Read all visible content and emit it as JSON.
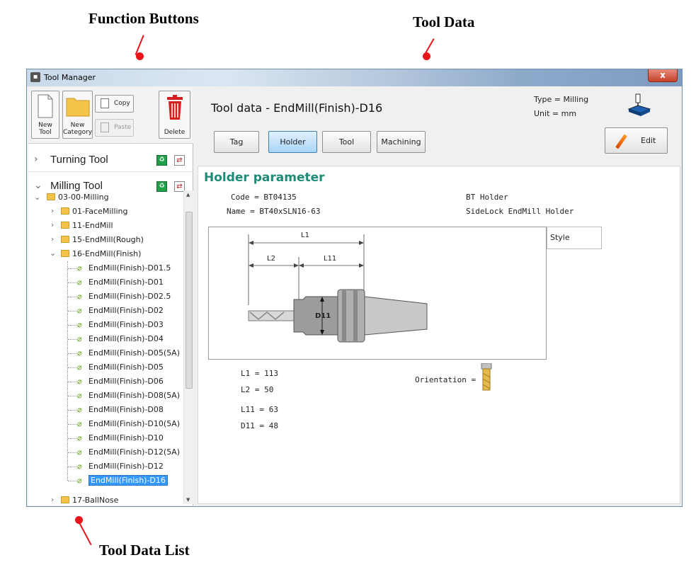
{
  "callouts": {
    "function_buttons": "Function Buttons",
    "tool_data": "Tool Data",
    "tool_data_list": "Tool Data List"
  },
  "window": {
    "title": "Tool Manager",
    "close": "x"
  },
  "toolbar": {
    "new_tool": "New Tool",
    "new_category": "New Category",
    "copy": "Copy",
    "paste": "Paste",
    "delete": "Delete"
  },
  "sections": {
    "turning": "Turning Tool",
    "milling": "Milling Tool"
  },
  "tree": {
    "root": "03-00-Milling",
    "folders": [
      "01-FaceMilling",
      "11-EndMill",
      "15-EndMill(Rough)",
      "16-EndMill(Finish)"
    ],
    "leaves": [
      "EndMill(Finish)-D01.5",
      "EndMill(Finish)-D01",
      "EndMill(Finish)-D02.5",
      "EndMill(Finish)-D02",
      "EndMill(Finish)-D03",
      "EndMill(Finish)-D04",
      "EndMill(Finish)-D05(5A)",
      "EndMill(Finish)-D05",
      "EndMill(Finish)-D06",
      "EndMill(Finish)-D08(5A)",
      "EndMill(Finish)-D08",
      "EndMill(Finish)-D10(5A)",
      "EndMill(Finish)-D10",
      "EndMill(Finish)-D12(5A)",
      "EndMill(Finish)-D12",
      "EndMill(Finish)-D16"
    ],
    "selected": "EndMill(Finish)-D16",
    "partial_next": "17-BallNose"
  },
  "tooldata": {
    "title": "Tool data - EndMill(Finish)-D16",
    "type": "Type = Milling",
    "unit": "Unit = mm",
    "tabs": [
      "Tag",
      "Holder",
      "Tool",
      "Machining"
    ],
    "active_tab": "Holder",
    "edit": "Edit"
  },
  "holder": {
    "heading": "Holder parameter",
    "code": "Code = BT04135",
    "name": "Name = BT40xSLN16-63",
    "holder_type": "BT Holder",
    "holder_desc": "SideLock EndMill Holder",
    "style_label": "Style",
    "dims": {
      "L1": "L1",
      "L2": "L2",
      "L11": "L11",
      "D11": "D11"
    },
    "values": {
      "l1": "L1 =  113",
      "l2": "L2 =  50",
      "l11": "L11  =  63",
      "d11": "D11 =  48"
    },
    "orientation": "Orientation ="
  }
}
